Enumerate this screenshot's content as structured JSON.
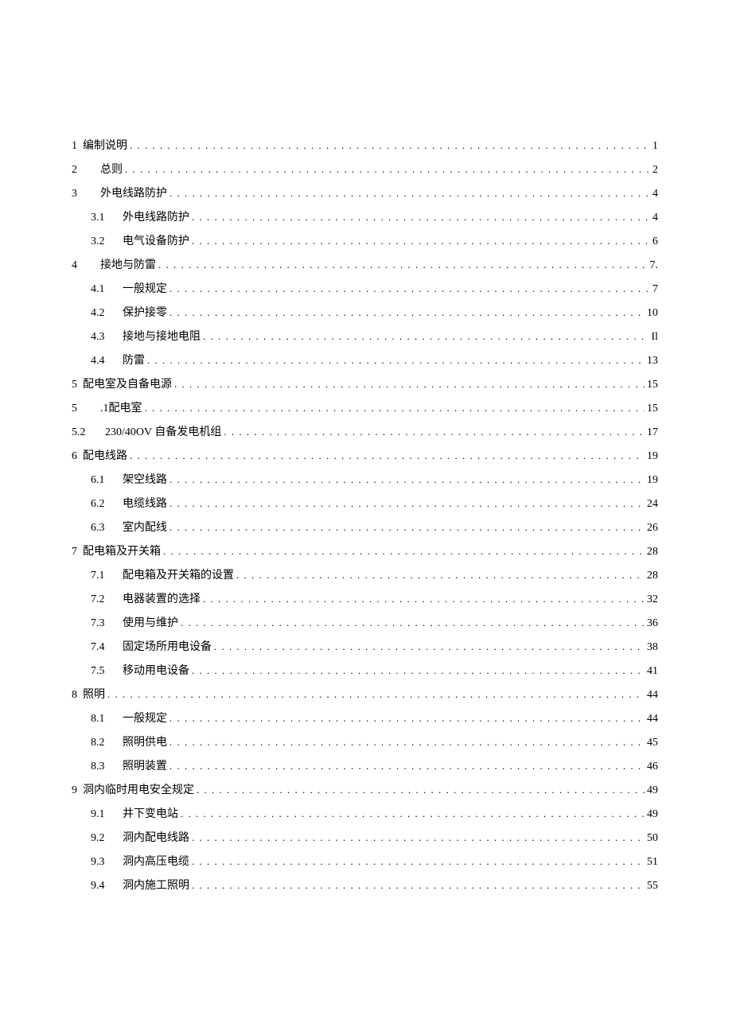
{
  "toc": [
    {
      "level": 1,
      "num": "1",
      "title": "编制说明",
      "page": "1"
    },
    {
      "level": 1,
      "num": "2",
      "title": "总则",
      "page": "2",
      "wideNum": true
    },
    {
      "level": 1,
      "num": "3",
      "title": "外电线路防护",
      "page": "4",
      "wideNum": true
    },
    {
      "level": 2,
      "num": "3.1",
      "title": "外电线路防护",
      "page": "4"
    },
    {
      "level": 2,
      "num": "3.2",
      "title": "电气设备防护",
      "page": "6"
    },
    {
      "level": 1,
      "num": "4",
      "title": "接地与防雷",
      "page": "7.",
      "wideNum": true
    },
    {
      "level": 2,
      "num": "4.1",
      "title": "一般规定",
      "page": "7"
    },
    {
      "level": 2,
      "num": "4.2",
      "title": "保护接零",
      "page": "10"
    },
    {
      "level": 2,
      "num": "4.3",
      "title": "接地与接地电阻",
      "page": "Il"
    },
    {
      "level": 2,
      "num": "4.4",
      "title": "防雷",
      "page": "13"
    },
    {
      "level": 1,
      "num": "5",
      "title": "配电室及自备电源",
      "page": "15"
    },
    {
      "level": 1,
      "num": "5",
      "title": ".1配电室",
      "page": "15",
      "wideNum": true
    },
    {
      "level": 1,
      "num": "5.2",
      "title": "230/40OV 自备发电机组",
      "page": "17",
      "indentText": true
    },
    {
      "level": 1,
      "num": "6",
      "title": "配电线路",
      "page": "19"
    },
    {
      "level": 2,
      "num": "6.1",
      "title": "架空线路",
      "page": "19"
    },
    {
      "level": 2,
      "num": "6.2",
      "title": "电缆线路",
      "page": "24"
    },
    {
      "level": 2,
      "num": "6.3",
      "title": "室内配线",
      "page": "26"
    },
    {
      "level": 1,
      "num": "7",
      "title": "配电箱及开关箱",
      "page": "28"
    },
    {
      "level": 2,
      "num": "7.1",
      "title": "配电箱及开关箱的设置",
      "page": "28"
    },
    {
      "level": 2,
      "num": "7.2",
      "title": "电器装置的选择",
      "page": "32"
    },
    {
      "level": 2,
      "num": "7.3",
      "title": "使用与维护",
      "page": "36"
    },
    {
      "level": 2,
      "num": "7.4",
      "title": "固定场所用电设备",
      "page": "38"
    },
    {
      "level": 2,
      "num": "7.5",
      "title": "移动用电设备",
      "page": "41"
    },
    {
      "level": 1,
      "num": "8",
      "title": "照明",
      "page": "44"
    },
    {
      "level": 2,
      "num": "8.1",
      "title": "一般规定",
      "page": "44"
    },
    {
      "level": 2,
      "num": "8.2",
      "title": "照明供电",
      "page": "45"
    },
    {
      "level": 2,
      "num": "8.3",
      "title": "照明装置",
      "page": "46"
    },
    {
      "level": 1,
      "num": "9",
      "title": "洞内临时用电安全规定",
      "page": "49"
    },
    {
      "level": 2,
      "num": "9.1",
      "title": "井下变电站",
      "page": "49"
    },
    {
      "level": 2,
      "num": "9.2",
      "title": "洞内配电线路",
      "page": "50"
    },
    {
      "level": 2,
      "num": "9.3",
      "title": "洞内高压电缆",
      "page": "51"
    },
    {
      "level": 2,
      "num": "9.4",
      "title": "洞内施工照明",
      "page": "55"
    }
  ]
}
